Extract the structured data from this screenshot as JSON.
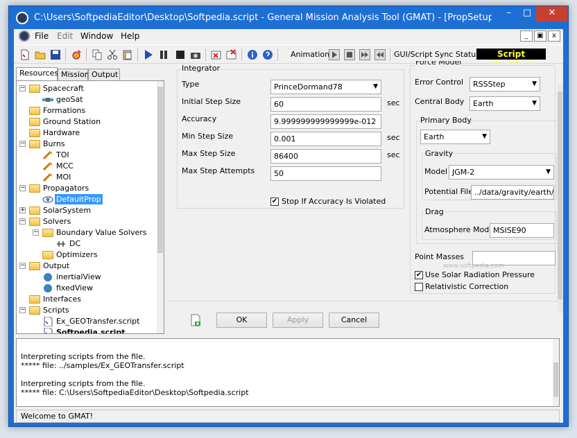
{
  "window": {
    "title": "C:\\Users\\SoftpediaEditor\\Desktop\\Softpedia.script - General Mission Analysis Tool (GMAT) - [PropSetup - D...",
    "min": "–",
    "max": "□",
    "close": "✕"
  },
  "menu": {
    "file": "File",
    "edit": "Edit",
    "window": "Window",
    "help": "Help",
    "mdi_min": "_",
    "mdi_restore": "▣",
    "mdi_close": "x"
  },
  "toolbar": {
    "animation_label": "Animation",
    "sync_label": "GUI/Script Sync Status:",
    "sync_status": "Script Modified",
    "colors": {
      "sync_bg": "#000000",
      "sync_fg": "#ffff33"
    }
  },
  "tabs": [
    "Resources",
    "Mission",
    "Output"
  ],
  "tree": [
    {
      "label": "Spacecraft",
      "icon": "folder-icon",
      "expander": "−"
    },
    {
      "label": "geoSat",
      "icon": "satellite-icon"
    },
    {
      "label": "Formations",
      "icon": "folder-icon"
    },
    {
      "label": "Ground Station",
      "icon": "folder-icon"
    },
    {
      "label": "Hardware",
      "icon": "folder-icon"
    },
    {
      "label": "Burns",
      "icon": "folder-icon",
      "expander": "−"
    },
    {
      "label": "TOI",
      "icon": "burn-icon"
    },
    {
      "label": "MCC",
      "icon": "burn-icon"
    },
    {
      "label": "MOI",
      "icon": "burn-icon"
    },
    {
      "label": "Propagators",
      "icon": "folder-icon",
      "expander": "−"
    },
    {
      "label": "DefaultProp",
      "icon": "propagator-icon"
    },
    {
      "label": "SolarSystem",
      "icon": "folder-icon",
      "expander": "+"
    },
    {
      "label": "Solvers",
      "icon": "folder-icon",
      "expander": "−"
    },
    {
      "label": "Boundary Value Solvers",
      "icon": "folder-icon",
      "expander": "−"
    },
    {
      "label": "DC",
      "icon": "solver-icon"
    },
    {
      "label": "Optimizers",
      "icon": "folder-icon"
    },
    {
      "label": "Output",
      "icon": "folder-icon",
      "expander": "−"
    },
    {
      "label": "inertialView",
      "icon": "globe-icon"
    },
    {
      "label": "fixedView",
      "icon": "globe-icon"
    },
    {
      "label": "Interfaces",
      "icon": "folder-icon"
    },
    {
      "label": "Scripts",
      "icon": "folder-icon",
      "expander": "−"
    },
    {
      "label": "Ex_GEOTransfer.script",
      "icon": "script-icon"
    },
    {
      "label": "Softpedia.script",
      "icon": "script-icon"
    }
  ],
  "integrator": {
    "group": "Integrator",
    "type_label": "Type",
    "type_value": "PrinceDormand78",
    "initial_step_label": "Initial Step Size",
    "initial_step_value": "60",
    "initial_step_unit": "sec",
    "accuracy_label": "Accuracy",
    "accuracy_value": "9.999999999999999e-012",
    "min_step_label": "Min Step Size",
    "min_step_value": "0.001",
    "min_step_unit": "sec",
    "max_step_label": "Max Step Size",
    "max_step_value": "86400",
    "max_step_unit": "sec",
    "max_attempts_label": "Max Step Attempts",
    "max_attempts_value": "50",
    "stop_label": "Stop If Accuracy Is Violated",
    "stop_checked": "✔"
  },
  "force_model": {
    "group": "Force Model",
    "error_control_label": "Error Control",
    "error_control_value": "RSSStep",
    "central_body_label": "Central Body",
    "central_body_value": "Earth",
    "primary_body_group": "Primary Body",
    "primary_body_value": "Earth",
    "gravity_group": "Gravity",
    "model_label": "Model",
    "model_value": "JGM-2",
    "potential_file_label": "Potential File",
    "potential_file_value": "../data/gravity/earth/J",
    "drag_group": "Drag",
    "atmosphere_label": "Atmosphere Model",
    "atmosphere_value": "MSISE90",
    "point_masses_label": "Point Masses",
    "srp_label": "Use Solar Radiation Pressure",
    "srp_checked": "✔",
    "relativistic_label": "Relativistic Correction"
  },
  "buttons": {
    "ok": "OK",
    "apply": "Apply",
    "cancel": "Cancel"
  },
  "log": [
    "Interpreting scripts from the file.",
    "***** file: ../samples/Ex_GEOTransfer.script",
    "",
    "Interpreting scripts from the file.",
    "***** file: C:\\Users\\SoftpediaEditor\\Desktop\\Softpedia.script"
  ],
  "status": "Welcome to GMAT!",
  "watermark": "www.softpedia.com"
}
